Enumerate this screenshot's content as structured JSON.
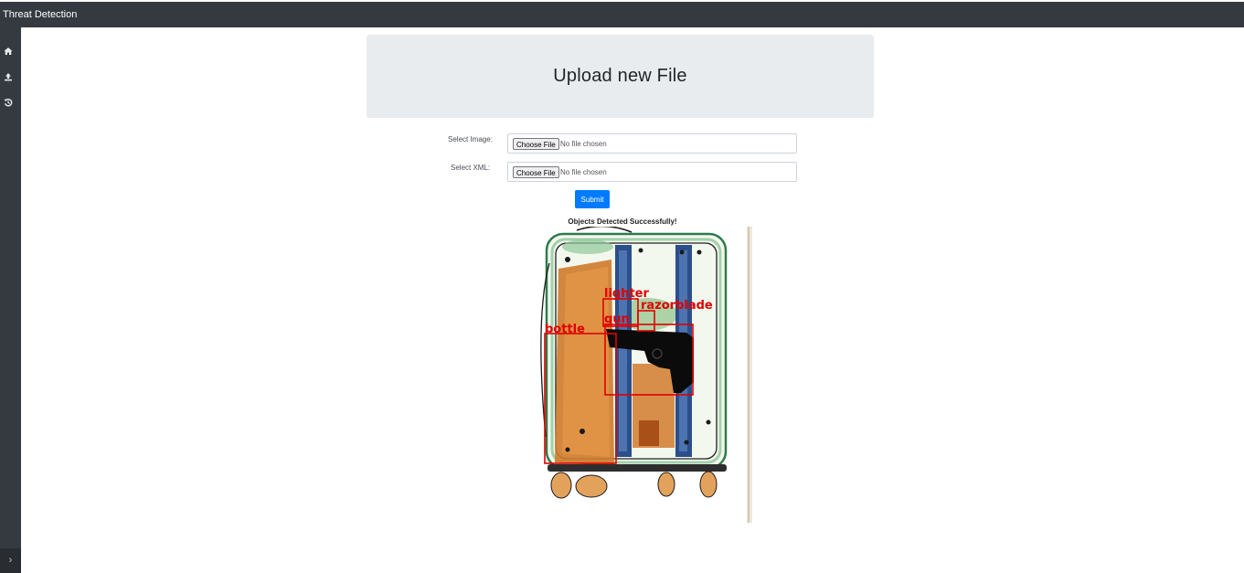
{
  "app": {
    "title": "Threat Detection"
  },
  "sidebar": {
    "items": [
      {
        "icon": "home-icon"
      },
      {
        "icon": "upload-icon"
      },
      {
        "icon": "history-icon"
      }
    ],
    "toggle_label": "›"
  },
  "header": {
    "title": "Upload new File"
  },
  "form": {
    "image_label": "Select Image:",
    "xml_label": "Select XML:",
    "choose_file_label": "Choose File",
    "no_file_text": "No file chosen",
    "submit_label": "Submit"
  },
  "result": {
    "message": "Objects Detected Successfully!",
    "detections": [
      {
        "label": "lighter"
      },
      {
        "label": "razorblade"
      },
      {
        "label": "gun"
      },
      {
        "label": "bottle"
      }
    ],
    "box_color": "#e00000"
  },
  "colors": {
    "nav": "#343a40",
    "accent": "#007bff",
    "jumbotron": "#e9ecef"
  }
}
